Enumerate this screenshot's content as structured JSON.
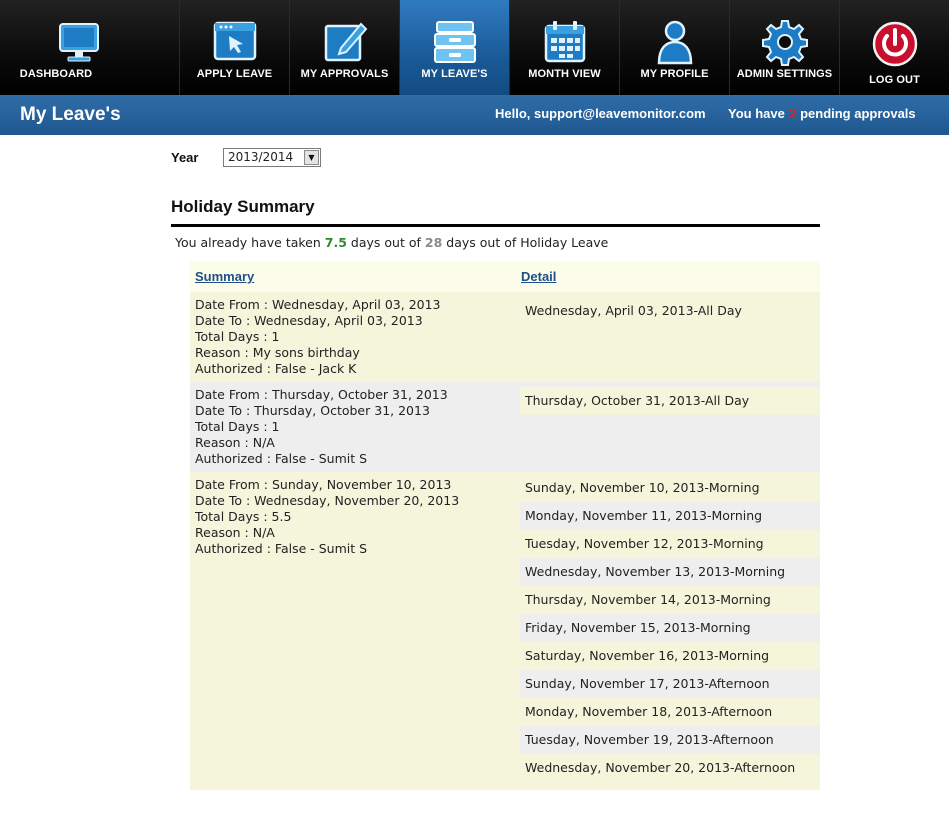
{
  "nav": [
    {
      "label": "DASHBOARD",
      "icon": "monitor-icon",
      "active": false
    },
    {
      "label": "APPLY LEAVE",
      "icon": "apply-window-icon",
      "active": false
    },
    {
      "label": "MY APPROVALS",
      "icon": "pencil-edit-icon",
      "active": false
    },
    {
      "label": "MY LEAVE'S",
      "icon": "archive-box-icon",
      "active": true
    },
    {
      "label": "MONTH VIEW",
      "icon": "calendar-icon",
      "active": false
    },
    {
      "label": "MY PROFILE",
      "icon": "user-icon",
      "active": false
    },
    {
      "label": "ADMIN SETTINGS",
      "icon": "gear-icon",
      "active": false
    },
    {
      "label": "LOG OUT",
      "icon": "power-icon",
      "active": false
    }
  ],
  "header": {
    "title": "My Leave's",
    "greeting": "Hello, support@leavemonitor.com",
    "pending_prefix": "You have",
    "pending_count": "2",
    "pending_suffix": "pending approvals"
  },
  "year": {
    "label": "Year",
    "selected": "2013/2014"
  },
  "summary": {
    "title": "Holiday Summary",
    "taken_prefix": "You already have taken",
    "taken_days": "7.5",
    "taken_mid": "days out of",
    "total_days": "28",
    "taken_suffix": "days out of Holiday Leave"
  },
  "table": {
    "headers": {
      "summary": "Summary",
      "detail": "Detail"
    },
    "groups": [
      {
        "summary": [
          "Date From : Wednesday, April 03, 2013",
          "Date To : Wednesday, April 03, 2013",
          "Total Days : 1",
          "Reason : My sons birthday",
          "Authorized : False - Jack K"
        ],
        "details": [
          "Wednesday, April 03, 2013-All Day"
        ]
      },
      {
        "summary": [
          "Date From : Thursday, October 31, 2013",
          "Date To : Thursday, October 31, 2013",
          "Total Days : 1",
          "Reason : N/A",
          "Authorized : False - Sumit S"
        ],
        "details": [
          "Thursday, October 31, 2013-All Day"
        ]
      },
      {
        "summary": [
          "Date From : Sunday, November 10, 2013",
          "Date To : Wednesday, November 20, 2013",
          "Total Days : 5.5",
          "Reason : N/A",
          "Authorized : False - Sumit S"
        ],
        "details": [
          "Sunday, November 10, 2013-Morning",
          "Monday, November 11, 2013-Morning",
          "Tuesday, November 12, 2013-Morning",
          "Wednesday, November 13, 2013-Morning",
          "Thursday, November 14, 2013-Morning",
          "Friday, November 15, 2013-Morning",
          "Saturday, November 16, 2013-Morning",
          "Sunday, November 17, 2013-Afternoon",
          "Monday, November 18, 2013-Afternoon",
          "Tuesday, November 19, 2013-Afternoon",
          "Wednesday, November 20, 2013-Afternoon"
        ]
      }
    ]
  },
  "colors": {
    "accent_blue": "#1f5790",
    "active_tab": "#1a5a98",
    "pending_count": "#e02020",
    "taken_days": "#2e8b2e",
    "row_odd": "#f5f5dc",
    "row_even": "#eeeeee",
    "header_bg": "#fcfceb"
  }
}
